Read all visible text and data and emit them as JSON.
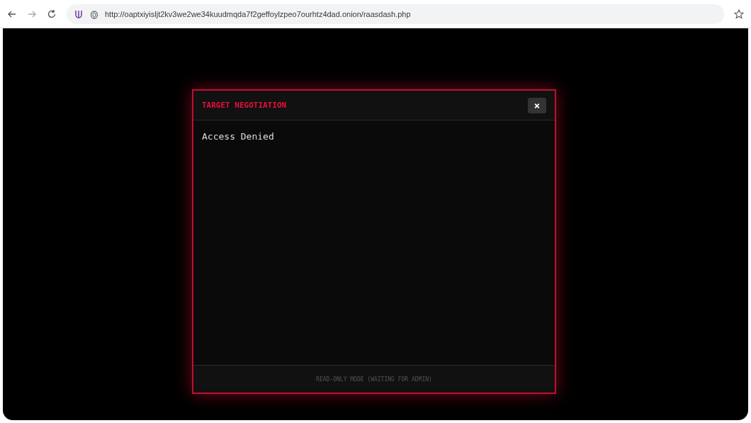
{
  "browser": {
    "url": "http://oaptxiyisljt2kv3we2we34kuudmqda7f2geffoylzpeo7ourhtz4dad.onion/raasdash.php"
  },
  "modal": {
    "title": "TARGET NEGOTIATION",
    "close": "×",
    "message": "Access Denied",
    "footer": "READ-ONLY MODE (WAITING FOR ADMIN)"
  }
}
